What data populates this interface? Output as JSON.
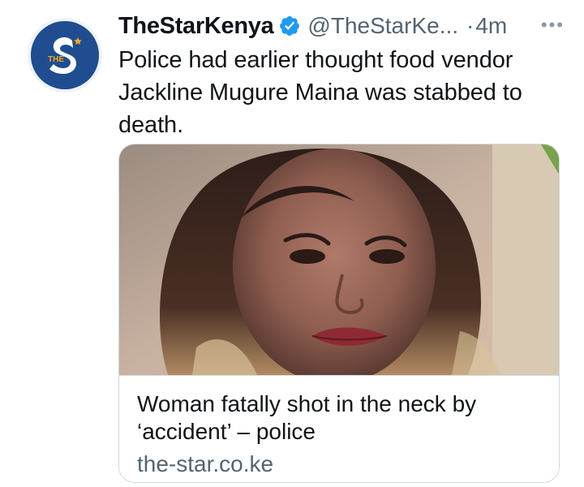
{
  "tweet": {
    "author": {
      "display_name": "TheStarKenya",
      "handle": "@TheStarKe...",
      "verified_icon": "verified-badge-icon",
      "avatar_text": "S",
      "avatar_small_text": "THE"
    },
    "separator": "·",
    "time": "4m",
    "more_icon": "more-options-icon",
    "text": "Police had earlier thought food vendor Jackline Mugure Maina was stabbed to death."
  },
  "card": {
    "image_icon": "article-photo",
    "title": "Woman fatally shot in the neck by ‘accident’ – police",
    "domain": "the-star.co.ke"
  },
  "colors": {
    "verified_blue": "#1d9bf0",
    "avatar_blue": "#1f4d8f",
    "text_primary": "#0f1419",
    "text_secondary": "#536471",
    "border": "#cfd9de"
  }
}
